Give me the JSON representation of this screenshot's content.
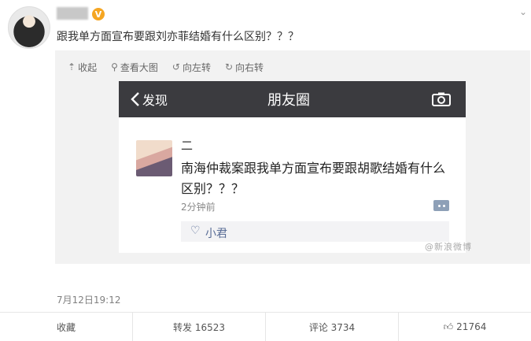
{
  "post": {
    "verified_badge": "V",
    "text": "跟我单方面宣布要跟刘亦菲结婚有什么区别？？？",
    "time": "7月12日19:12",
    "more_icon": "chevron-down-icon"
  },
  "toolbar": {
    "collapse": "收起",
    "view_large": "查看大图",
    "rotate_left": "向左转",
    "rotate_right": "向右转",
    "icons": {
      "collapse": "collapse-icon",
      "view_large": "magnifier-icon",
      "rotate_left": "rotate-left-icon",
      "rotate_right": "rotate-right-icon"
    }
  },
  "screenshot": {
    "back_label": "发现",
    "title": "朋友圈",
    "friend_name": "二",
    "friend_text": "南海仲裁案跟我单方面宣布要跟胡歌结婚有什么区别？？？",
    "time_ago": "2分钟前",
    "liked_by": "小君",
    "watermark": "@新浪微博"
  },
  "actions": {
    "favorite": "收藏",
    "repost": "转发 16523",
    "comment": "评论 3734",
    "like": "21764"
  },
  "colors": {
    "wechat_header": "#3b3b3f",
    "link_blue": "#576b95",
    "verified_orange": "#f5a623"
  }
}
